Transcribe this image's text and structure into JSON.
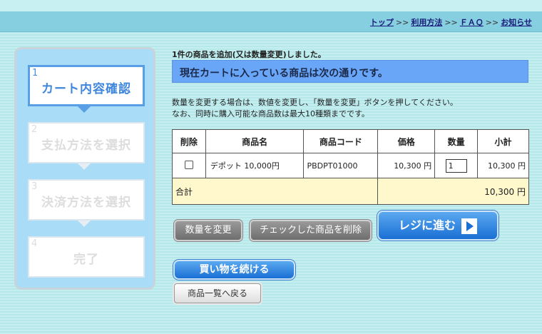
{
  "nav": {
    "links": [
      "トップ",
      "利用方法",
      "ＦＡＱ",
      "お知らせ"
    ],
    "separator": ">>"
  },
  "steps": [
    {
      "num": "1",
      "label": "カート内容確認",
      "active": true
    },
    {
      "num": "2",
      "label": "支払方法を選択",
      "active": false
    },
    {
      "num": "3",
      "label": "決済方法を選択",
      "active": false
    },
    {
      "num": "4",
      "label": "完了",
      "active": false
    }
  ],
  "messages": {
    "added": "1件の商品を追加(又は数量変更)しました。",
    "banner": "現在カートに入っている商品は次の通りです。",
    "note_line1": "数量を変更する場合は、数値を変更し、「数量を変更」ボタンを押してください。",
    "note_line2": "なお、同時に購入可能な商品数は最大10種類までです。"
  },
  "table": {
    "headers": [
      "削除",
      "商品名",
      "商品コード",
      "価格",
      "数量",
      "小計"
    ],
    "rows": [
      {
        "name": "デポット 10,000円",
        "code": "PBDPT01000",
        "price": "10,300 円",
        "qty": "1",
        "subtotal": "10,300 円",
        "checked": false
      }
    ],
    "total_label": "合計",
    "total_value": "10,300 円"
  },
  "buttons": {
    "change_qty": "数量を変更",
    "delete_checked": "チェックした商品を削除",
    "checkout": "レジに進む",
    "continue_shopping": "買い物を続ける",
    "back_to_list": "商品一覧へ戻る"
  },
  "colors": {
    "accent_blue": "#1a6fd4",
    "banner": "#6aa6f8",
    "total_row": "#fff8cc",
    "navbar": "#86cfe0"
  }
}
